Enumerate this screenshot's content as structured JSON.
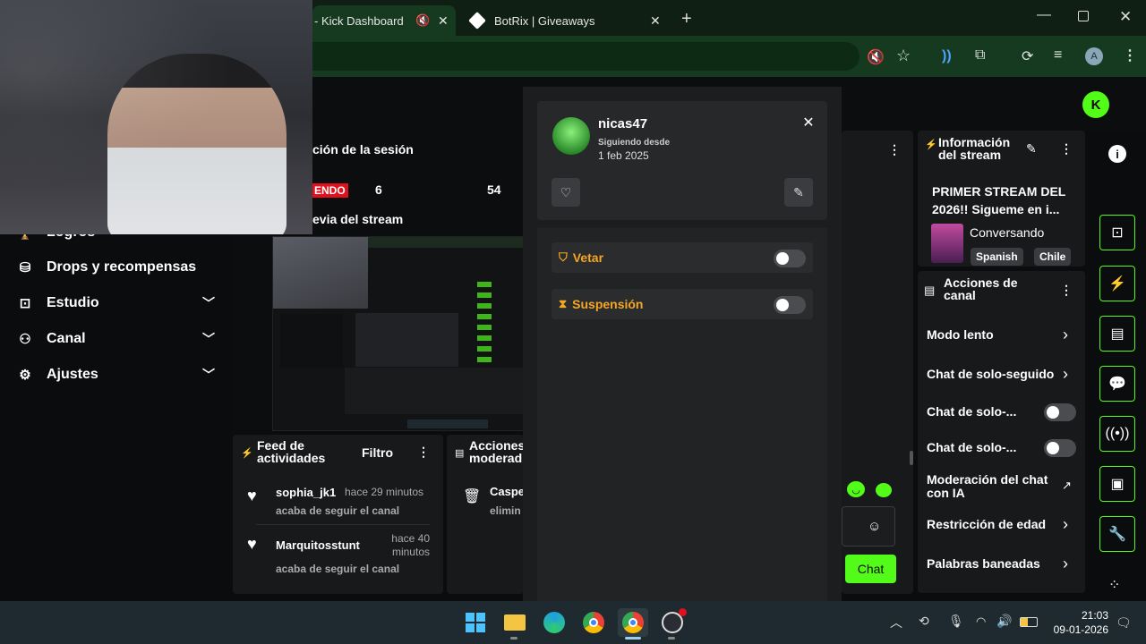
{
  "browser": {
    "tabs": [
      {
        "title": "- Kick Dashboard",
        "muted": true,
        "active": true
      },
      {
        "title": "BotRix | Giveaways",
        "active": false
      }
    ],
    "profile_initial": "A"
  },
  "session": {
    "title": "ción de la sesión",
    "live_badge": "ENDO",
    "stat1": "6",
    "stat2": "54",
    "preview_title": "evia del stream"
  },
  "sidebar": {
    "items": [
      {
        "label": "Logros",
        "icon": "trophy-icon"
      },
      {
        "label": "Drops y recompensas",
        "icon": "gift-icon"
      },
      {
        "label": "Estudio",
        "icon": "studio-icon",
        "chevron": true
      },
      {
        "label": "Canal",
        "icon": "users-icon",
        "chevron": true
      },
      {
        "label": "Ajustes",
        "icon": "gear-icon",
        "chevron": true
      }
    ]
  },
  "user_card": {
    "username": "nicas47",
    "following_label": "Siguiendo desde",
    "following_date": "1 feb 2025"
  },
  "mod_actions": {
    "ban_label": "Vetar",
    "timeout_label": "Suspensión",
    "ban_enabled": false,
    "timeout_enabled": false
  },
  "stream_info": {
    "title": "Información del stream",
    "stream_title": "PRIMER STREAM DEL 2026!! Sigueme en i...",
    "category": "Conversando",
    "tags": [
      "Spanish",
      "Chile"
    ]
  },
  "channel_actions": {
    "title": "Acciones de canal",
    "items": [
      {
        "label": "Modo lento",
        "type": "arrow"
      },
      {
        "label": "Chat de solo-seguido",
        "type": "arrow"
      },
      {
        "label": "Chat de solo-...",
        "type": "toggle",
        "enabled": false
      },
      {
        "label": "Chat de solo-...",
        "type": "toggle",
        "enabled": false
      },
      {
        "label": "Moderación del chat con IA",
        "type": "external"
      },
      {
        "label": "Restricción de edad",
        "type": "arrow"
      },
      {
        "label": "Palabras baneadas",
        "type": "arrow"
      }
    ]
  },
  "feed": {
    "title": "Feed de actividades",
    "filter_label": "Filtro",
    "items": [
      {
        "user": "sophia_jk1",
        "time": "hace 29 minutos",
        "action": "acaba de seguir el canal"
      },
      {
        "user": "Marquitosstunt",
        "time": "hace 40 minutos",
        "action": "acaba de seguir el canal"
      }
    ]
  },
  "mod_feed": {
    "title": "Acciones moderad",
    "item_user": "Caspe",
    "item_action": "elimin"
  },
  "chat": {
    "send_label": "Chat"
  },
  "taskbar": {
    "time": "21:03",
    "date": "09-01-2026"
  },
  "colors": {
    "kick_green": "#53fc18",
    "accent_orange": "#f5a623",
    "live_red": "#e0101e"
  }
}
